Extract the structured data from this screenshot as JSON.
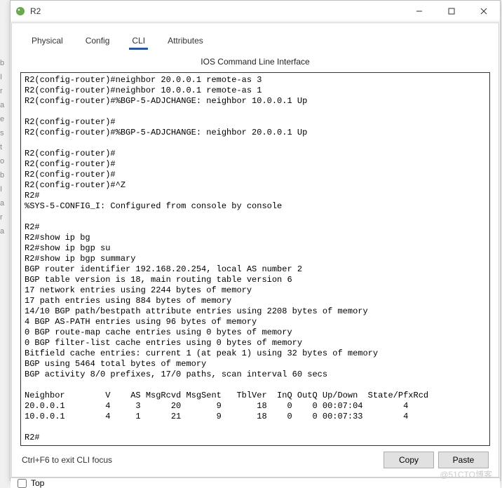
{
  "window": {
    "title": "R2",
    "controls": {
      "min": "−",
      "max": "□",
      "close": "×"
    }
  },
  "tabs": {
    "items": [
      {
        "label": "Physical",
        "active": false
      },
      {
        "label": "Config",
        "active": false
      },
      {
        "label": "CLI",
        "active": true
      },
      {
        "label": "Attributes",
        "active": false
      }
    ]
  },
  "cli": {
    "panelTitle": "IOS Command Line Interface",
    "lines": [
      "R2(config-router)#neighbor 20.0.0.1 remote-as 3",
      "R2(config-router)#neighbor 10.0.0.1 remote-as 1",
      "R2(config-router)#%BGP-5-ADJCHANGE: neighbor 10.0.0.1 Up",
      "",
      "R2(config-router)#",
      "R2(config-router)#%BGP-5-ADJCHANGE: neighbor 20.0.0.1 Up",
      "",
      "R2(config-router)#",
      "R2(config-router)#",
      "R2(config-router)#",
      "R2(config-router)#^Z",
      "R2#",
      "%SYS-5-CONFIG_I: Configured from console by console",
      "",
      "R2#",
      "R2#show ip bg",
      "R2#show ip bgp su",
      "R2#show ip bgp summary",
      "BGP router identifier 192.168.20.254, local AS number 2",
      "BGP table version is 18, main routing table version 6",
      "17 network entries using 2244 bytes of memory",
      "17 path entries using 884 bytes of memory",
      "14/10 BGP path/bestpath attribute entries using 2208 bytes of memory",
      "4 BGP AS-PATH entries using 96 bytes of memory",
      "0 BGP route-map cache entries using 0 bytes of memory",
      "0 BGP filter-list cache entries using 0 bytes of memory",
      "Bitfield cache entries: current 1 (at peak 1) using 32 bytes of memory",
      "BGP using 5464 total bytes of memory",
      "BGP activity 8/0 prefixes, 17/0 paths, scan interval 60 secs",
      "",
      "Neighbor        V    AS MsgRcvd MsgSent   TblVer  InQ OutQ Up/Down  State/PfxRcd",
      "20.0.0.1        4     3      20       9       18    0    0 00:07:04        4",
      "10.0.0.1        4     1      21       9       18    0    0 00:07:33        4",
      "",
      "R2#"
    ],
    "neighbors_table": {
      "columns": [
        "Neighbor",
        "V",
        "AS",
        "MsgRcvd",
        "MsgSent",
        "TblVer",
        "InQ",
        "OutQ",
        "Up/Down",
        "State/PfxRcd"
      ],
      "rows": [
        {
          "Neighbor": "20.0.0.1",
          "V": 4,
          "AS": 3,
          "MsgRcvd": 20,
          "MsgSent": 9,
          "TblVer": 18,
          "InQ": 0,
          "OutQ": 0,
          "Up/Down": "00:07:04",
          "State/PfxRcd": 4
        },
        {
          "Neighbor": "10.0.0.1",
          "V": 4,
          "AS": 1,
          "MsgRcvd": 21,
          "MsgSent": 9,
          "TblVer": 18,
          "InQ": 0,
          "OutQ": 0,
          "Up/Down": "00:07:33",
          "State/PfxRcd": 4
        }
      ]
    }
  },
  "footer": {
    "hint": "Ctrl+F6 to exit CLI focus",
    "copy_label": "Copy",
    "paste_label": "Paste"
  },
  "bottom": {
    "top_checkbox_label": "Top",
    "top_checked": false
  },
  "watermark": "@51CTO博客"
}
